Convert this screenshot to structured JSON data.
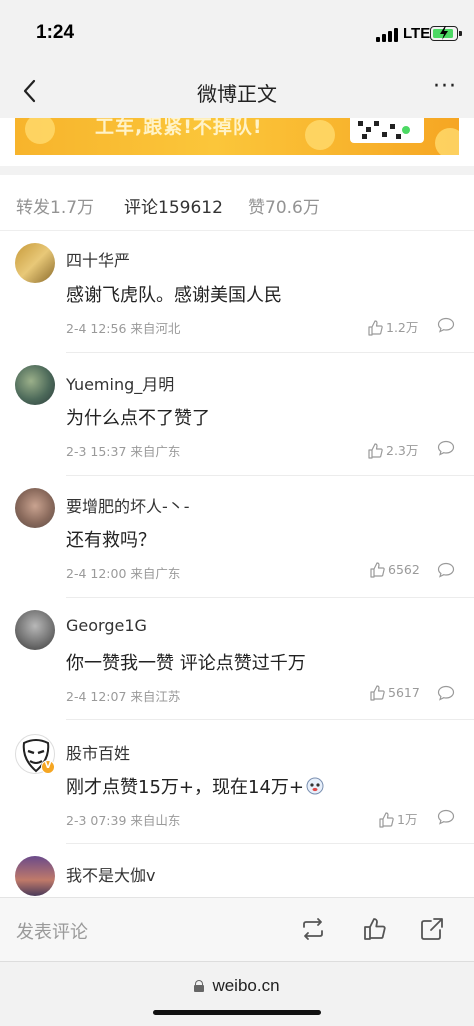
{
  "status_bar": {
    "time": "1:24",
    "network": "LTE",
    "battery": "charging"
  },
  "nav": {
    "title": "微博正文",
    "back_icon": "chevron-left-icon",
    "more_label": "···"
  },
  "banner": {
    "text": "工车,跟紧!不掉队!"
  },
  "tabs": [
    {
      "label": "转发1.7万",
      "active": false
    },
    {
      "label": "评论159612",
      "active": true
    },
    {
      "label": "赞70.6万",
      "active": false
    }
  ],
  "comments": [
    {
      "name": "四十华严",
      "text": "感谢飞虎队。感谢美国人民",
      "meta": "2-4 12:56 来自河北",
      "likes": "1.2万"
    },
    {
      "name": "Yueming_月明",
      "text": "为什么点不了赞了",
      "meta": "2-3 15:37 来自广东",
      "likes": "2.3万"
    },
    {
      "name": "要增肥的坏人-丶-",
      "text": "还有救吗？",
      "meta": "2-4 12:00 来自广东",
      "likes": "6562"
    },
    {
      "name": "George1G",
      "text": "你一赞我一赞 评论点赞过千万",
      "meta": "2-4 12:07 来自江苏",
      "likes": "5617"
    },
    {
      "name": "股市百姓",
      "text": "刚才点赞15万+，现在14万+",
      "meta": "2-3 07:39 来自山东",
      "likes": "1万",
      "vip_badge": "V"
    },
    {
      "name": "我不是大伽v"
    }
  ],
  "bottom_bar": {
    "post_comment": "发表评论"
  },
  "safari": {
    "url": "weibo.cn"
  },
  "colors": {
    "background": "#ffffff",
    "bar_background": "#f2f2f2",
    "muted_text": "#9a9a9a",
    "banner_orange": "#f7b42c"
  }
}
